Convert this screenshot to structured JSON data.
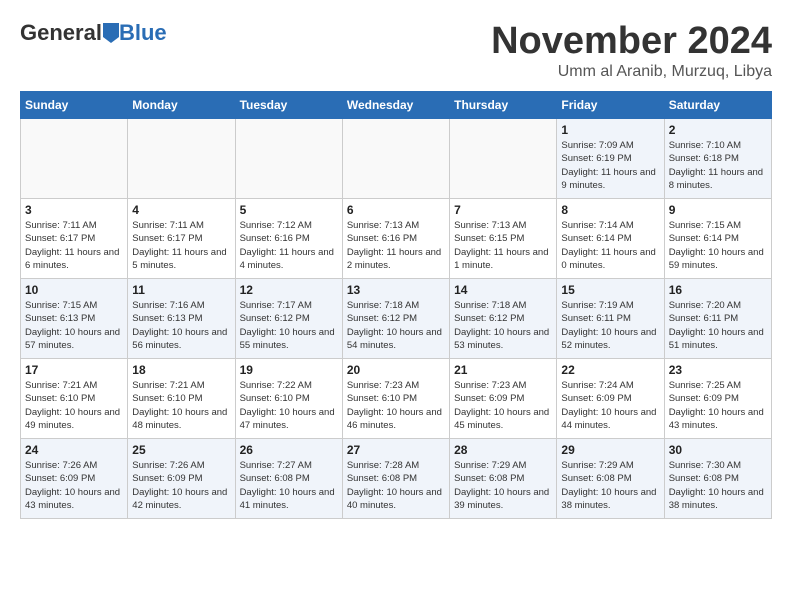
{
  "header": {
    "logo_general": "General",
    "logo_blue": "Blue",
    "month_title": "November 2024",
    "subtitle": "Umm al Aranib, Murzuq, Libya"
  },
  "days_of_week": [
    "Sunday",
    "Monday",
    "Tuesday",
    "Wednesday",
    "Thursday",
    "Friday",
    "Saturday"
  ],
  "weeks": [
    [
      {
        "day": "",
        "info": ""
      },
      {
        "day": "",
        "info": ""
      },
      {
        "day": "",
        "info": ""
      },
      {
        "day": "",
        "info": ""
      },
      {
        "day": "",
        "info": ""
      },
      {
        "day": "1",
        "info": "Sunrise: 7:09 AM\nSunset: 6:19 PM\nDaylight: 11 hours and 9 minutes."
      },
      {
        "day": "2",
        "info": "Sunrise: 7:10 AM\nSunset: 6:18 PM\nDaylight: 11 hours and 8 minutes."
      }
    ],
    [
      {
        "day": "3",
        "info": "Sunrise: 7:11 AM\nSunset: 6:17 PM\nDaylight: 11 hours and 6 minutes."
      },
      {
        "day": "4",
        "info": "Sunrise: 7:11 AM\nSunset: 6:17 PM\nDaylight: 11 hours and 5 minutes."
      },
      {
        "day": "5",
        "info": "Sunrise: 7:12 AM\nSunset: 6:16 PM\nDaylight: 11 hours and 4 minutes."
      },
      {
        "day": "6",
        "info": "Sunrise: 7:13 AM\nSunset: 6:16 PM\nDaylight: 11 hours and 2 minutes."
      },
      {
        "day": "7",
        "info": "Sunrise: 7:13 AM\nSunset: 6:15 PM\nDaylight: 11 hours and 1 minute."
      },
      {
        "day": "8",
        "info": "Sunrise: 7:14 AM\nSunset: 6:14 PM\nDaylight: 11 hours and 0 minutes."
      },
      {
        "day": "9",
        "info": "Sunrise: 7:15 AM\nSunset: 6:14 PM\nDaylight: 10 hours and 59 minutes."
      }
    ],
    [
      {
        "day": "10",
        "info": "Sunrise: 7:15 AM\nSunset: 6:13 PM\nDaylight: 10 hours and 57 minutes."
      },
      {
        "day": "11",
        "info": "Sunrise: 7:16 AM\nSunset: 6:13 PM\nDaylight: 10 hours and 56 minutes."
      },
      {
        "day": "12",
        "info": "Sunrise: 7:17 AM\nSunset: 6:12 PM\nDaylight: 10 hours and 55 minutes."
      },
      {
        "day": "13",
        "info": "Sunrise: 7:18 AM\nSunset: 6:12 PM\nDaylight: 10 hours and 54 minutes."
      },
      {
        "day": "14",
        "info": "Sunrise: 7:18 AM\nSunset: 6:12 PM\nDaylight: 10 hours and 53 minutes."
      },
      {
        "day": "15",
        "info": "Sunrise: 7:19 AM\nSunset: 6:11 PM\nDaylight: 10 hours and 52 minutes."
      },
      {
        "day": "16",
        "info": "Sunrise: 7:20 AM\nSunset: 6:11 PM\nDaylight: 10 hours and 51 minutes."
      }
    ],
    [
      {
        "day": "17",
        "info": "Sunrise: 7:21 AM\nSunset: 6:10 PM\nDaylight: 10 hours and 49 minutes."
      },
      {
        "day": "18",
        "info": "Sunrise: 7:21 AM\nSunset: 6:10 PM\nDaylight: 10 hours and 48 minutes."
      },
      {
        "day": "19",
        "info": "Sunrise: 7:22 AM\nSunset: 6:10 PM\nDaylight: 10 hours and 47 minutes."
      },
      {
        "day": "20",
        "info": "Sunrise: 7:23 AM\nSunset: 6:10 PM\nDaylight: 10 hours and 46 minutes."
      },
      {
        "day": "21",
        "info": "Sunrise: 7:23 AM\nSunset: 6:09 PM\nDaylight: 10 hours and 45 minutes."
      },
      {
        "day": "22",
        "info": "Sunrise: 7:24 AM\nSunset: 6:09 PM\nDaylight: 10 hours and 44 minutes."
      },
      {
        "day": "23",
        "info": "Sunrise: 7:25 AM\nSunset: 6:09 PM\nDaylight: 10 hours and 43 minutes."
      }
    ],
    [
      {
        "day": "24",
        "info": "Sunrise: 7:26 AM\nSunset: 6:09 PM\nDaylight: 10 hours and 43 minutes."
      },
      {
        "day": "25",
        "info": "Sunrise: 7:26 AM\nSunset: 6:09 PM\nDaylight: 10 hours and 42 minutes."
      },
      {
        "day": "26",
        "info": "Sunrise: 7:27 AM\nSunset: 6:08 PM\nDaylight: 10 hours and 41 minutes."
      },
      {
        "day": "27",
        "info": "Sunrise: 7:28 AM\nSunset: 6:08 PM\nDaylight: 10 hours and 40 minutes."
      },
      {
        "day": "28",
        "info": "Sunrise: 7:29 AM\nSunset: 6:08 PM\nDaylight: 10 hours and 39 minutes."
      },
      {
        "day": "29",
        "info": "Sunrise: 7:29 AM\nSunset: 6:08 PM\nDaylight: 10 hours and 38 minutes."
      },
      {
        "day": "30",
        "info": "Sunrise: 7:30 AM\nSunset: 6:08 PM\nDaylight: 10 hours and 38 minutes."
      }
    ]
  ]
}
